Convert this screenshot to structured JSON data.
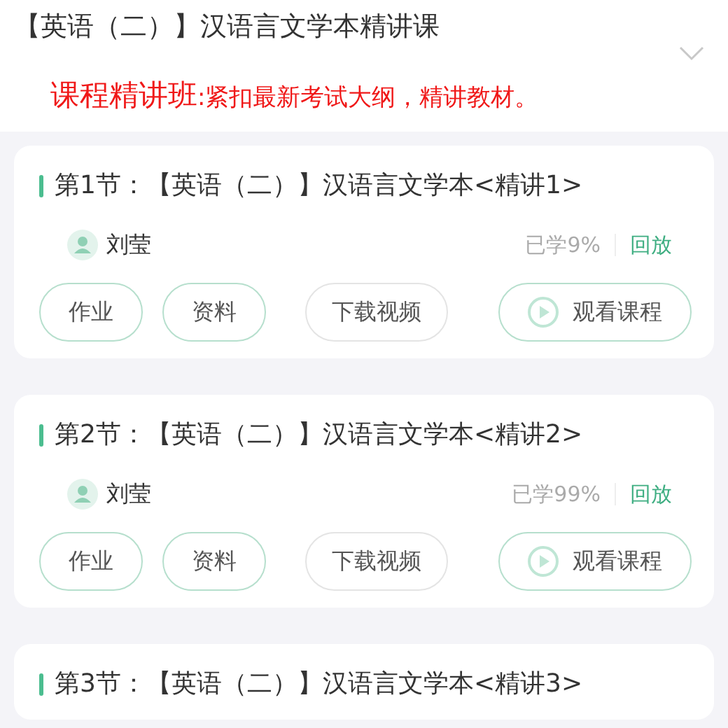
{
  "header": {
    "title": "【英语（二）】汉语言文学本精讲课"
  },
  "banner": {
    "title": "课程精讲班",
    "text": ":紧扣最新考试大纲，精讲教材。"
  },
  "lessons": [
    {
      "title": "第1节：【英语（二）】汉语言文学本<精讲1>",
      "teacher": "刘莹",
      "progress": "已学9%",
      "status": "回放",
      "buttons": [
        {
          "label": "作业",
          "kind": "outline"
        },
        {
          "label": "资料",
          "kind": "outline"
        },
        {
          "label": "下载视频",
          "kind": "muted"
        },
        {
          "label": "观看课程",
          "kind": "play"
        }
      ]
    },
    {
      "title": "第2节：【英语（二）】汉语言文学本<精讲2>",
      "teacher": "刘莹",
      "progress": "已学99%",
      "status": "回放",
      "buttons": [
        {
          "label": "作业",
          "kind": "outline"
        },
        {
          "label": "资料",
          "kind": "outline"
        },
        {
          "label": "下载视频",
          "kind": "muted"
        },
        {
          "label": "观看课程",
          "kind": "play"
        }
      ]
    },
    {
      "title": "第3节：【英语（二）】汉语言文学本<精讲3>"
    }
  ]
}
